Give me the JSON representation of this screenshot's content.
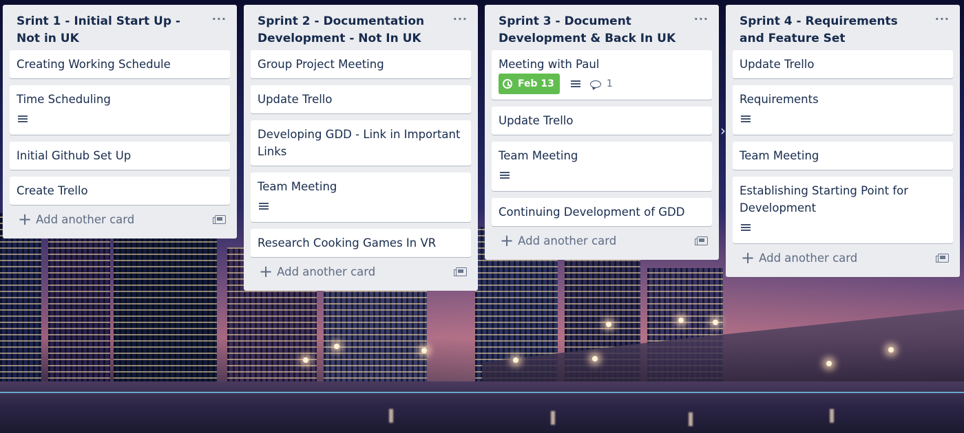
{
  "lists": [
    {
      "title": "Srint 1 - Initial Start Up - Not in UK",
      "menu_label": "···",
      "add_card_label": "Add another card",
      "cards": [
        {
          "title": "Creating Working Schedule"
        },
        {
          "title": "Time Scheduling",
          "has_description": true
        },
        {
          "title": "Initial Github Set Up"
        },
        {
          "title": "Create Trello"
        }
      ]
    },
    {
      "title": "Sprint 2 - Documentation Development - Not In UK",
      "menu_label": "···",
      "add_card_label": "Add another card",
      "cards": [
        {
          "title": "Group Project Meeting"
        },
        {
          "title": "Update Trello"
        },
        {
          "title": "Developing GDD - Link in Important Links"
        },
        {
          "title": "Team Meeting",
          "has_description": true
        },
        {
          "title": "Research Cooking Games In VR"
        }
      ]
    },
    {
      "title": "Sprint 3 - Document Development & Back In UK",
      "menu_label": "···",
      "add_card_label": "Add another card",
      "cards": [
        {
          "title": "Meeting with Paul",
          "due": "Feb 13",
          "has_description": true,
          "comments": "1"
        },
        {
          "title": "Update Trello"
        },
        {
          "title": "Team Meeting",
          "has_description": true
        },
        {
          "title": "Continuing Development of GDD"
        }
      ]
    },
    {
      "title": "Sprint 4 - Requirements and Feature Set",
      "menu_label": "···",
      "add_card_label": "Add another card",
      "cards": [
        {
          "title": "Update Trello"
        },
        {
          "title": "Requirements",
          "has_description": true
        },
        {
          "title": "Team Meeting"
        },
        {
          "title": "Establishing Starting Point for Development",
          "has_description": true
        }
      ]
    }
  ],
  "colors": {
    "list_bg": "#ebecf0",
    "card_bg": "#ffffff",
    "due_badge": "#61bd4f",
    "title_text": "#172b4d"
  },
  "icons": [
    "menu-dots-icon",
    "description-icon",
    "clock-icon",
    "comment-icon",
    "plus-icon",
    "card-template-icon",
    "scroll-right-icon"
  ]
}
